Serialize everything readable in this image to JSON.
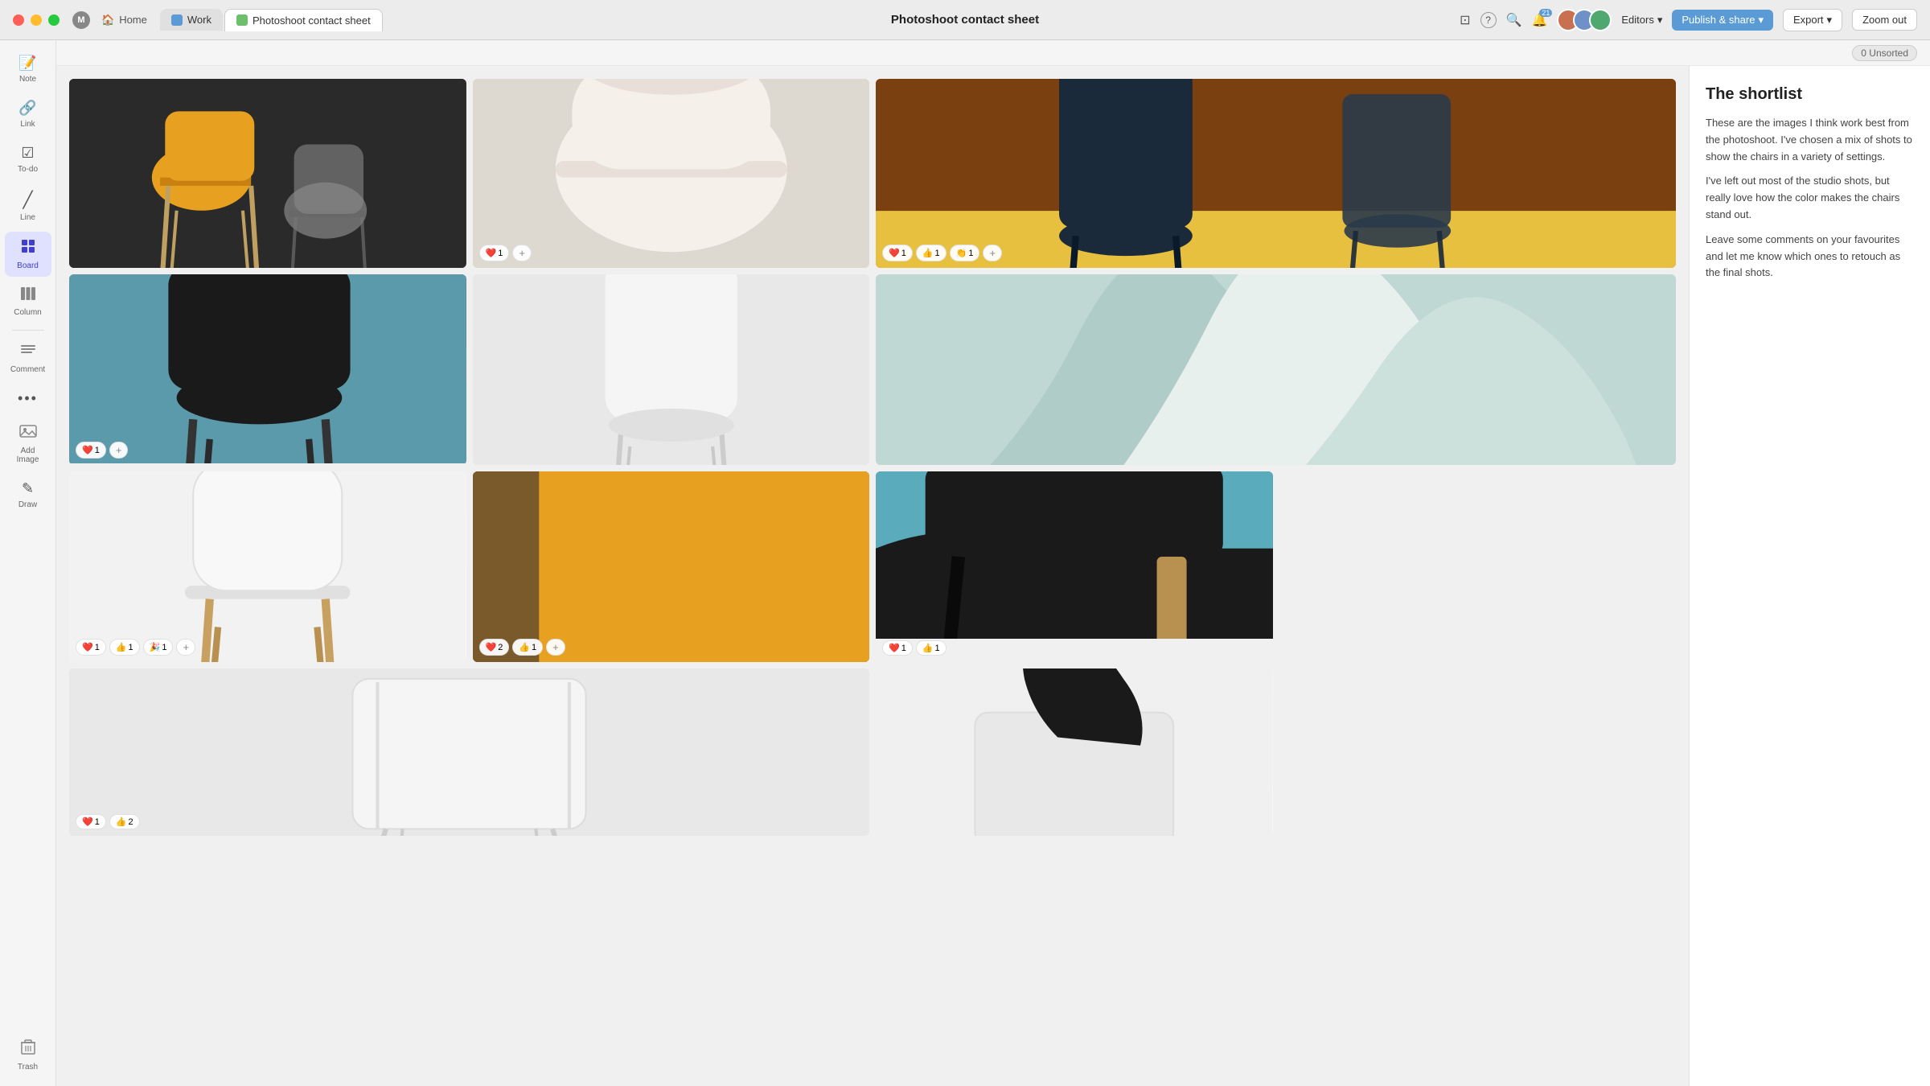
{
  "titlebar": {
    "traffic_lights": [
      "red",
      "yellow",
      "green"
    ],
    "tabs": [
      {
        "id": "home",
        "label": "Home",
        "icon": "home",
        "active": false
      },
      {
        "id": "work",
        "label": "Work",
        "icon": "work",
        "active": false
      },
      {
        "id": "photoshoot",
        "label": "Photoshoot contact sheet",
        "icon": "active",
        "active": true
      }
    ],
    "m_label": "M",
    "page_title": "Photoshoot contact sheet",
    "notification_count": "21",
    "editors_label": "Editors",
    "publish_label": "Publish & share",
    "export_label": "Export",
    "zoom_label": "Zoom out"
  },
  "sidebar": {
    "items": [
      {
        "id": "note",
        "label": "Note",
        "icon": "📝"
      },
      {
        "id": "link",
        "label": "Link",
        "icon": "🔗"
      },
      {
        "id": "todo",
        "label": "To-do",
        "icon": "☑️"
      },
      {
        "id": "line",
        "label": "Line",
        "icon": "✏️"
      },
      {
        "id": "board",
        "label": "Board",
        "icon": "⊞",
        "active": true
      },
      {
        "id": "column",
        "label": "Column",
        "icon": "▥"
      },
      {
        "id": "comment",
        "label": "Comment",
        "icon": "💬"
      },
      {
        "id": "more",
        "label": "···",
        "icon": "···"
      },
      {
        "id": "addimage",
        "label": "Add Image",
        "icon": "🖼️"
      },
      {
        "id": "draw",
        "label": "Draw",
        "icon": "✏️"
      }
    ],
    "trash_label": "Trash"
  },
  "topbar": {
    "unsorted_label": "0 Unsorted"
  },
  "note": {
    "title": "The shortlist",
    "paragraphs": [
      "These are the images I think work best from the photoshoot. I've chosen a mix of shots to show the chairs in a variety of settings.",
      "I've left out most of the studio shots, but really love how the color makes the chairs stand out.",
      "Leave some comments on your favourites and let me know which ones to retouch as the final shots."
    ]
  },
  "images": [
    {
      "id": "img-1",
      "style": "img-1",
      "alt": "Yellow and grey chairs on dark background",
      "reactions": []
    },
    {
      "id": "img-2",
      "style": "img-2",
      "alt": "White chair close-up",
      "reactions": [
        {
          "emoji": "❤️",
          "count": "1"
        },
        {
          "type": "add"
        }
      ]
    },
    {
      "id": "img-3",
      "style": "img-3",
      "alt": "Two dark chairs on orange-brown background",
      "reactions": [
        {
          "emoji": "❤️",
          "count": "1"
        },
        {
          "emoji": "👍",
          "count": "1"
        },
        {
          "emoji": "👏",
          "count": "1"
        },
        {
          "type": "add"
        }
      ]
    },
    {
      "id": "img-4",
      "style": "img-4",
      "alt": "Black chair on teal background",
      "reactions": [
        {
          "emoji": "❤️",
          "count": "1"
        },
        {
          "type": "add"
        }
      ]
    },
    {
      "id": "img-5",
      "style": "img-5",
      "alt": "White chair in soft light",
      "reactions": []
    },
    {
      "id": "img-6",
      "style": "img-6 img-wide",
      "alt": "Teal and white chair curves close-up",
      "reactions": []
    },
    {
      "id": "img-7",
      "style": "img-7",
      "alt": "White molded chair on wooden legs",
      "reactions": [
        {
          "emoji": "❤️",
          "count": "1"
        },
        {
          "emoji": "👍",
          "count": "1"
        },
        {
          "emoji": "🎉",
          "count": "1"
        },
        {
          "type": "add"
        }
      ]
    },
    {
      "id": "img-8",
      "style": "img-8",
      "alt": "Yellow chair in brown setting",
      "reactions": [
        {
          "emoji": "❤️",
          "count": "2"
        },
        {
          "emoji": "👍",
          "count": "1"
        },
        {
          "type": "add"
        }
      ]
    },
    {
      "id": "img-9",
      "style": "img-9",
      "alt": "Black chair on teal background close-up",
      "reactions": [
        {
          "emoji": "❤️",
          "count": "1"
        },
        {
          "emoji": "👍",
          "count": "1"
        }
      ]
    },
    {
      "id": "img-10",
      "style": "img-10",
      "alt": "White wire chair minimal",
      "reactions": [
        {
          "emoji": "❤️",
          "count": "1"
        },
        {
          "emoji": "👍",
          "count": "2"
        }
      ]
    },
    {
      "id": "img-11",
      "style": "img-11",
      "alt": "White chair with black draped fabric",
      "reactions": []
    }
  ],
  "icons": {
    "note": "📝",
    "link": "🔗",
    "todo": "☑",
    "line": "╱",
    "board": "⊞",
    "column": "▥",
    "comment": "☰",
    "more": "•••",
    "addimage": "⊕",
    "draw": "✎",
    "trash": "🗑",
    "search": "⌕",
    "bell": "🔔",
    "question": "?",
    "device": "⊡",
    "chevron_down": "▾"
  }
}
